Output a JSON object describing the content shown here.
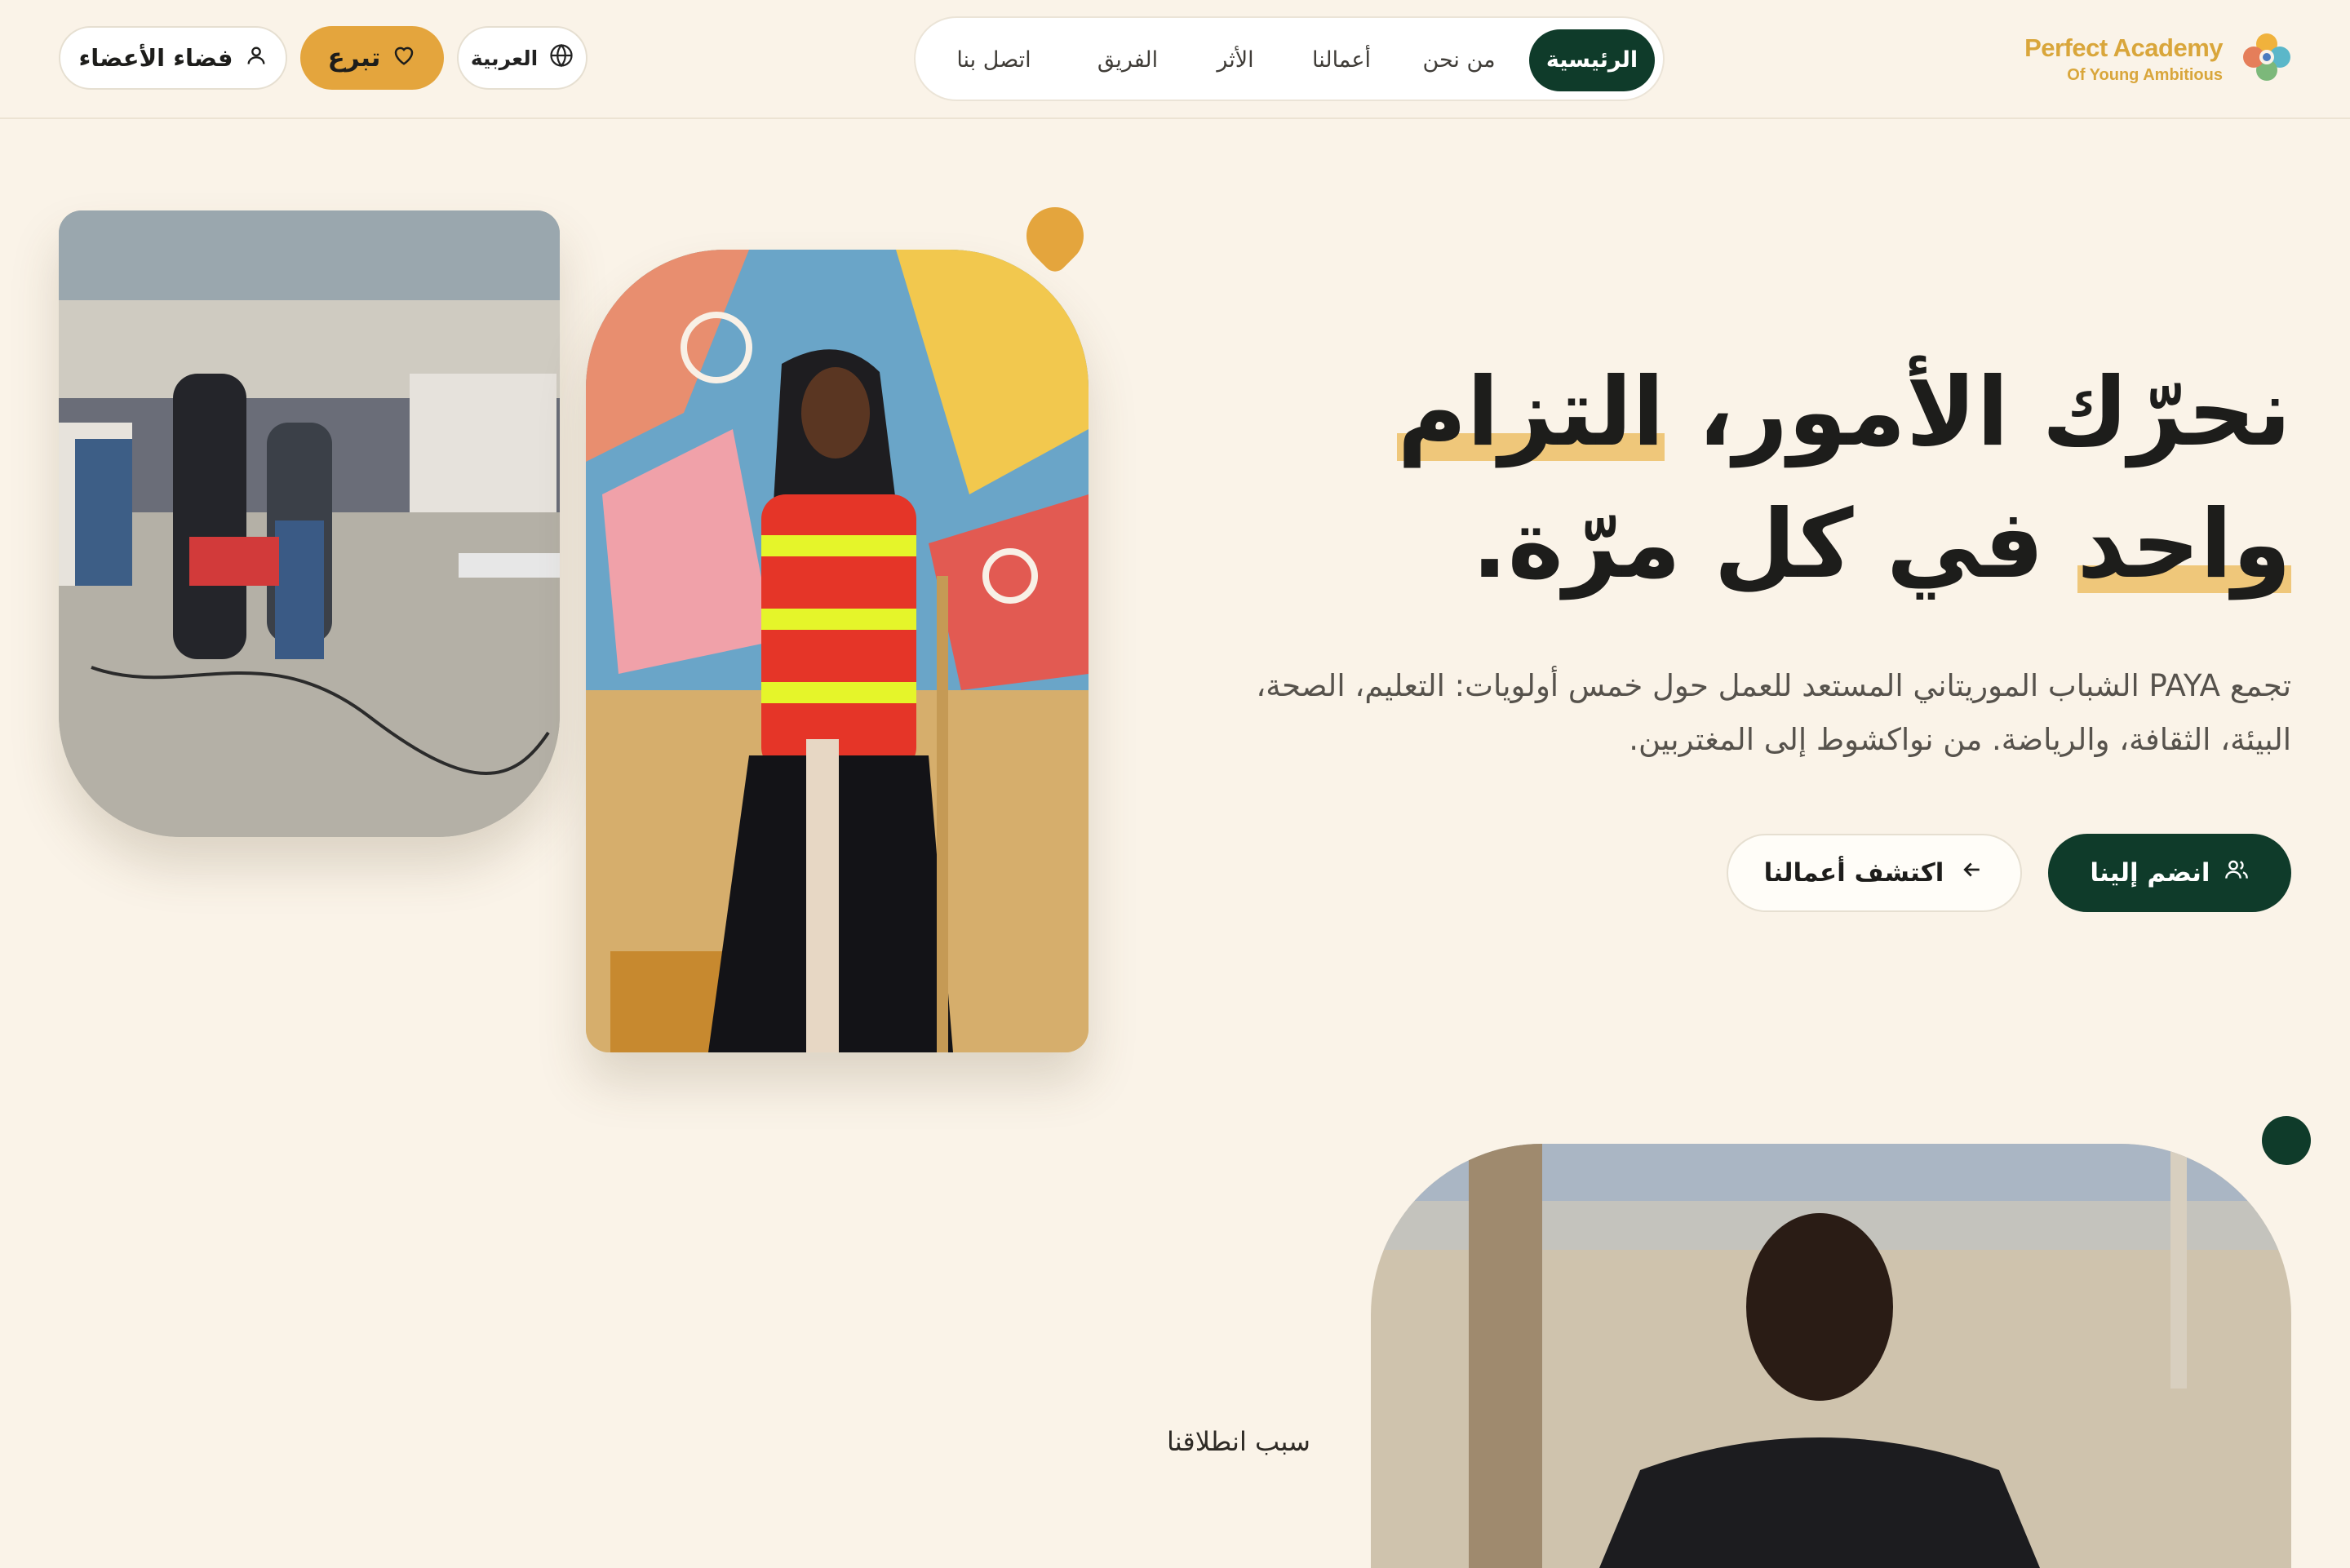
{
  "brand": {
    "name": "Perfect Academy",
    "tagline": "Of Young Ambitious"
  },
  "nav": {
    "items": [
      {
        "label": "الرئيسية",
        "active": true
      },
      {
        "label": "من نحن",
        "active": false
      },
      {
        "label": "أعمالنا",
        "active": false
      },
      {
        "label": "الأثر",
        "active": false
      },
      {
        "label": "الفريق",
        "active": false
      },
      {
        "label": "اتصل بنا",
        "active": false
      }
    ]
  },
  "header_actions": {
    "language_label": "العربية",
    "donate_label": "تبرع",
    "members_label": "فضاء الأعضاء"
  },
  "hero": {
    "headline_line1_plain": "نحرّك الأمور، ",
    "headline_line1_highlight": "التزام",
    "headline_line2_highlight": "واحد",
    "headline_line2_plain": " في كل مرّة.",
    "subtitle": "تجمع PAYA الشباب الموريتاني المستعد للعمل حول خمس أولويات: التعليم، الصحة، البيئة، الثقافة، والرياضة. من نواكشوط إلى المغتربين.",
    "primary_cta": "انضم إلينا",
    "secondary_cta": "اكتشف أعمالنا"
  },
  "section": {
    "label": "سبب انطلاقنا"
  },
  "colors": {
    "background": "#faf3e8",
    "primary_green": "#0f3b2a",
    "accent_yellow": "#e4a53d",
    "highlight": "#efc77a"
  },
  "icons": {
    "logo": "flower-logo-icon",
    "language": "globe-icon",
    "donate": "heart-icon",
    "members": "user-icon",
    "join": "users-icon",
    "discover": "arrow-left-icon"
  }
}
